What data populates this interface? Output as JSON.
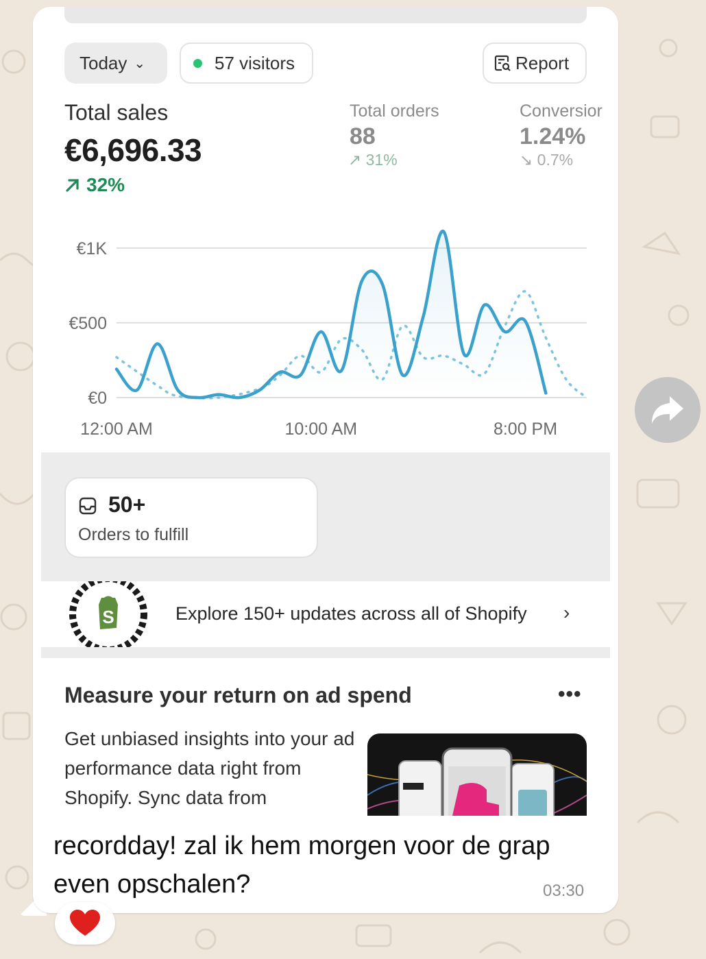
{
  "chat": {
    "message": "recordday! zal ik hem morgen voor de grap even opschalen?",
    "time": "03:30",
    "reaction": "❤️"
  },
  "dashboard": {
    "period_label": "Today",
    "visitors_label": "57 visitors",
    "report_label": "Report",
    "total_sales": {
      "label": "Total sales",
      "value": "€6,696.33",
      "change": "32%"
    },
    "total_orders": {
      "label": "Total orders",
      "value": "88",
      "change": "31%"
    },
    "conversion": {
      "label": "Conversior",
      "value": "1.24%",
      "change": "0.7%"
    },
    "orders_card": {
      "count": "50+",
      "label": "Orders to fulfill"
    },
    "editions": {
      "text": "Explore 150+ updates across all of Shopify"
    },
    "ad_card": {
      "title": "Measure your return on ad spend",
      "more": "•••",
      "body": "Get unbiased insights into your ad performance data right from Shopify. Sync data from"
    }
  },
  "colors": {
    "accent_green": "#1f8a56",
    "chart_line": "#3aa0cc",
    "visitor_dot": "#29c473"
  },
  "chart_data": {
    "type": "line",
    "y_tick_labels": [
      "€1K",
      "€500",
      "€0"
    ],
    "y_ticks": [
      1000,
      500,
      0
    ],
    "x_tick_labels": [
      "12:00 AM",
      "10:00 AM",
      "8:00 PM"
    ],
    "ylim": [
      0,
      1100
    ],
    "xlim": [
      0,
      23
    ],
    "grid": true,
    "series": [
      {
        "style": "solid",
        "x": [
          0,
          1,
          2,
          3,
          4,
          5,
          6,
          7,
          8,
          9,
          10,
          11,
          12,
          13,
          14,
          15,
          16,
          17,
          18,
          19,
          20,
          21
        ],
        "y": [
          190,
          50,
          360,
          50,
          0,
          20,
          0,
          50,
          170,
          150,
          440,
          180,
          780,
          760,
          150,
          540,
          1110,
          290,
          620,
          440,
          510,
          30
        ]
      },
      {
        "style": "dotted",
        "x": [
          0,
          2,
          3,
          5,
          7,
          8,
          9,
          10,
          11,
          12,
          13,
          14,
          15,
          16,
          17,
          18,
          19,
          20,
          21,
          22,
          23
        ],
        "y": [
          270,
          80,
          10,
          0,
          60,
          150,
          280,
          170,
          390,
          320,
          120,
          480,
          270,
          280,
          220,
          160,
          480,
          710,
          400,
          120,
          0
        ]
      }
    ]
  }
}
